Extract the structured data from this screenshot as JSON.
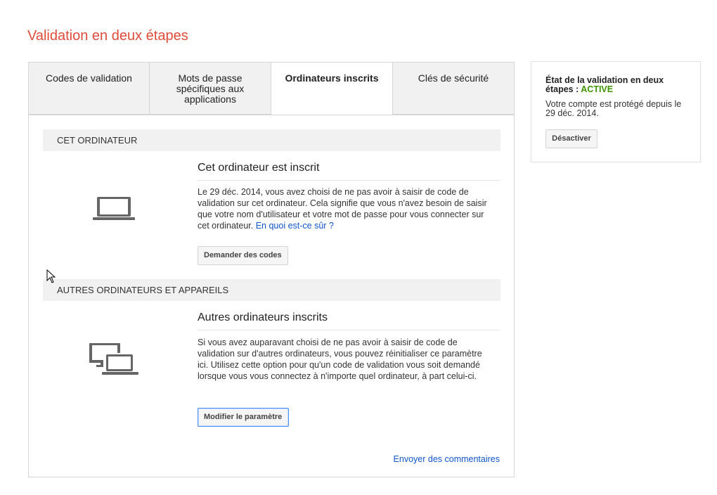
{
  "page": {
    "title": "Validation en deux étapes"
  },
  "tabs": [
    {
      "label": "Codes de validation",
      "active": false
    },
    {
      "label": "Mots de passe spécifiques aux applications",
      "active": false
    },
    {
      "label": "Ordinateurs inscrits",
      "active": true
    },
    {
      "label": "Clés de sécurité",
      "active": false
    }
  ],
  "this_computer": {
    "header": "CET ORDINATEUR",
    "title": "Cet ordinateur est inscrit",
    "description": "Le 29 déc. 2014, vous avez choisi de ne pas avoir à saisir de code de validation sur cet ordinateur. Cela signifie que vous n'avez besoin de saisir que votre nom d'utilisateur et votre mot de passe pour vous connecter sur cet ordinateur.",
    "link": "En quoi est-ce sûr ?",
    "button": "Demander des codes",
    "icon": "laptop-icon"
  },
  "other_computers": {
    "header": "AUTRES ORDINATEURS ET APPAREILS",
    "title": "Autres ordinateurs inscrits",
    "description": "Si vous avez auparavant choisi de ne pas avoir à saisir de code de validation sur d'autres ordinateurs, vous pouvez réinitialiser ce paramètre ici. Utilisez cette option pour qu'un code de validation vous soit demandé lorsque vous vous connectez à n'importe quel ordinateur, à part celui-ci.",
    "button": "Modifier le paramètre",
    "icon": "devices-icon"
  },
  "footer": {
    "feedback": "Envoyer des commentaires"
  },
  "status_card": {
    "title": "État de la validation en deux étapes :",
    "status": "ACTIVE",
    "text": "Votre compte est protégé depuis le 29 déc. 2014.",
    "button": "Désactiver"
  },
  "colors": {
    "title_red": "#dd4b39",
    "link_blue": "#1155cc",
    "status_green": "#3d9400"
  }
}
